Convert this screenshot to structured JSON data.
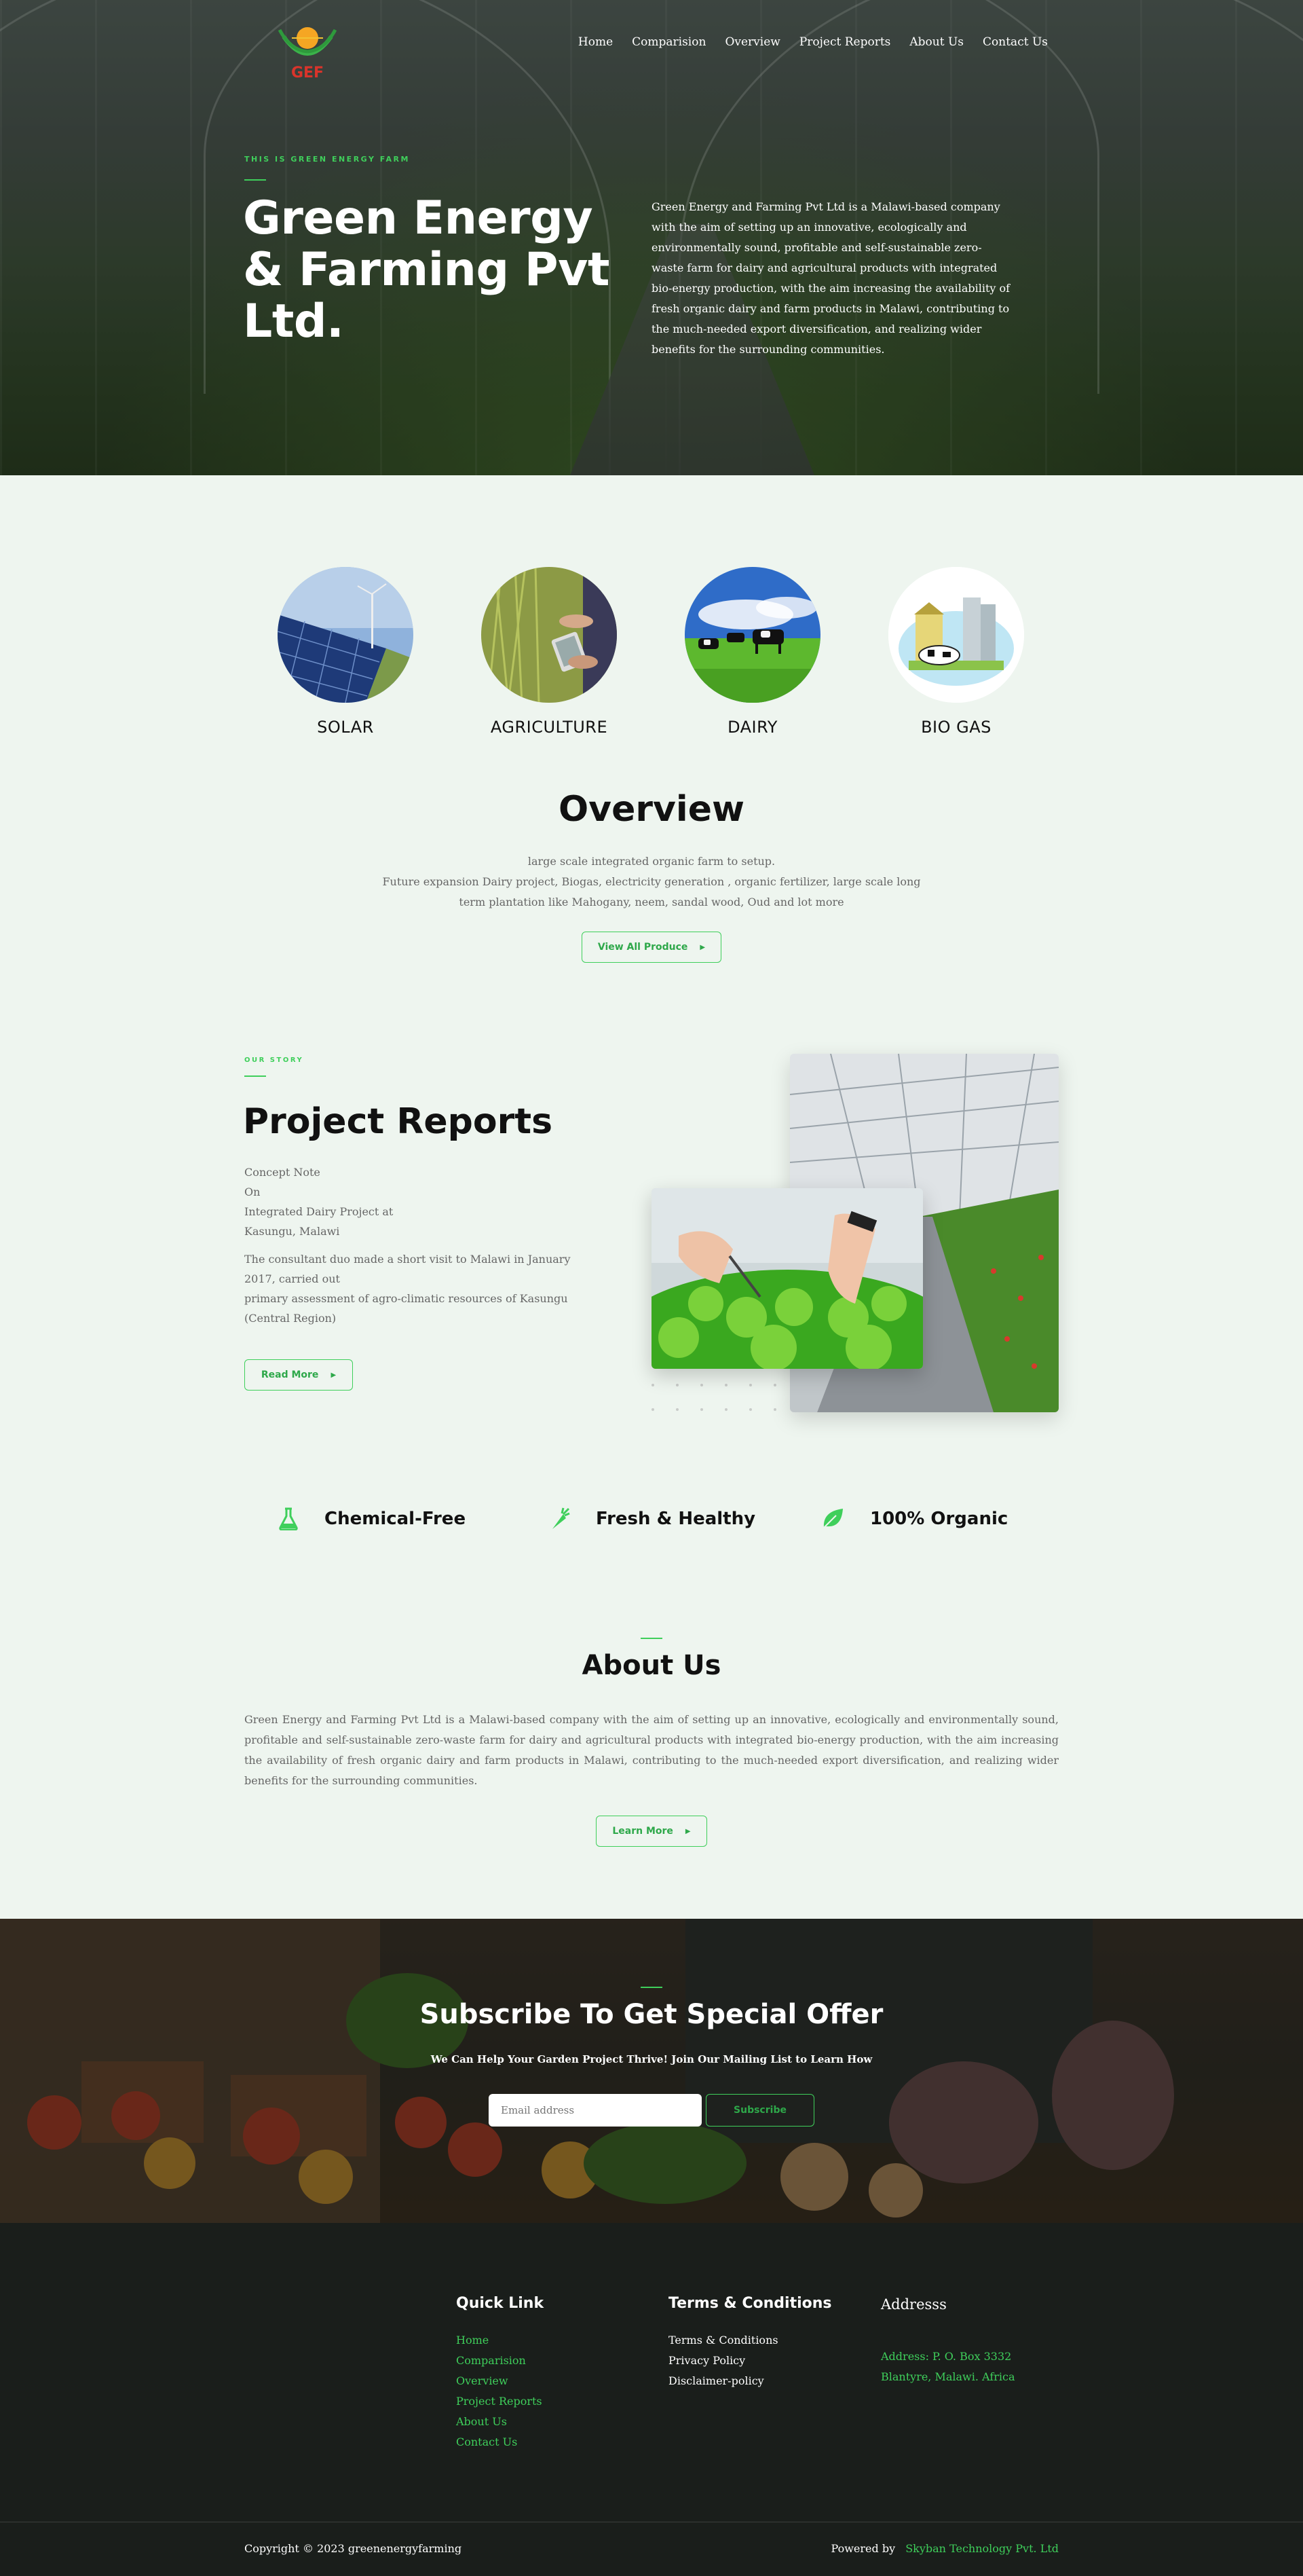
{
  "brand": {
    "logo_text": "GEF",
    "accent_color": "#3fcf5b"
  },
  "nav": {
    "items": [
      "Home",
      "Comparision",
      "Overview",
      "Project Reports",
      "About Us",
      "Contact Us"
    ]
  },
  "hero": {
    "eyebrow": "THIS IS GREEN ENERGY FARM",
    "title": "Green Energy & Farming Pvt Ltd.",
    "description": "Green Energy and Farming Pvt Ltd is a Malawi-based company with the aim of setting up an innovative, ecologically and environmentally sound, profitable and self-sustainable zero-waste farm for dairy and agricultural products with integrated bio-energy production, with the aim increasing the availability of fresh organic dairy and farm products in Malawi, contributing to the much-needed export diversification, and realizing wider benefits for the surrounding communities."
  },
  "categories": [
    "SOLAR",
    "AGRICULTURE",
    "DAIRY",
    "BIO GAS"
  ],
  "overview": {
    "title": "Overview",
    "lines": [
      "large scale integrated organic farm to setup.",
      "Future expansion Dairy project, Biogas, electricity generation , organic fertilizer, large scale long",
      "term plantation like Mahogany, neem, sandal wood, Oud and lot more"
    ],
    "button": "View All Produce"
  },
  "project": {
    "eyebrow": "OUR STORY",
    "title": "Project Reports",
    "lines1": [
      "Concept Note",
      "On",
      "Integrated Dairy Project at",
      "Kasungu, Malawi"
    ],
    "lines2": [
      "The consultant duo made a short visit to Malawi in January 2017, carried out",
      "primary assessment of agro-climatic resources of Kasungu (Central Region)"
    ],
    "button": "Read More"
  },
  "features": [
    {
      "label": "Chemical-Free",
      "icon": "flask-icon"
    },
    {
      "label": "Fresh & Healthy",
      "icon": "carrot-icon"
    },
    {
      "label": "100% Organic",
      "icon": "leaf-icon"
    }
  ],
  "about": {
    "title": "About Us",
    "text": "Green Energy and Farming Pvt Ltd is a Malawi-based company with the aim of setting up an innovative, ecologically and environmentally sound, profitable and self-sustainable zero-waste farm for dairy and agricultural products with integrated bio-energy production, with the aim increasing the availability of fresh organic dairy and farm products in Malawi, contributing to the much-needed export diversification, and realizing wider benefits for the surrounding communities.",
    "button": "Learn More"
  },
  "subscribe": {
    "title": "Subscribe To Get Special Offer",
    "text": "We Can Help Your Garden Project Thrive! Join Our Mailing List to Learn How",
    "placeholder": "Email address",
    "button": "Subscribe"
  },
  "footer": {
    "quick_title": "Quick Link",
    "quick_links": [
      "Home",
      "Comparision",
      "Overview",
      "Project Reports",
      "About Us",
      "Contact Us"
    ],
    "terms_title": "Terms & Conditions",
    "terms_links": [
      "Terms & Conditions",
      "Privacy Policy",
      "Disclaimer-policy"
    ],
    "address_title": "Addresss",
    "address_lines": [
      "Address: P. O. Box 3332",
      "Blantyre, Malawi. Africa"
    ],
    "copyright": "Copyright © 2023 greenenergyfarming",
    "powered_label": "Powered by",
    "powered_link": "Skyban Technology Pvt. Ltd"
  }
}
